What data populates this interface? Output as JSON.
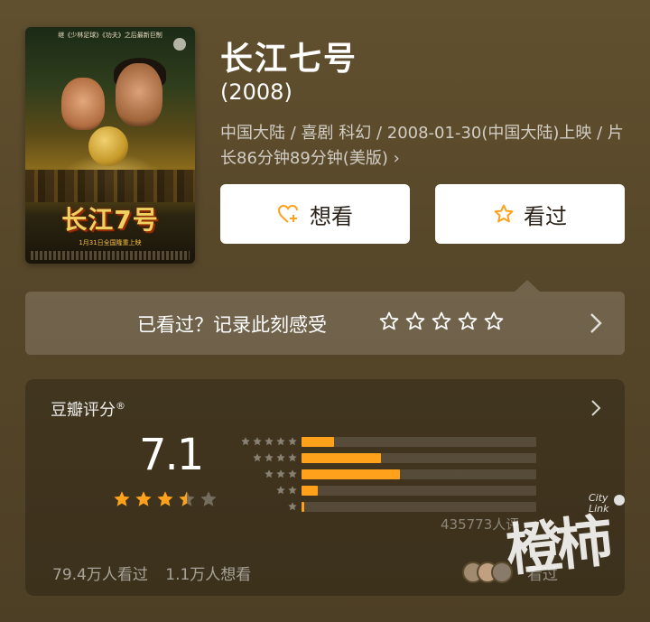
{
  "movie": {
    "title": "长江七号",
    "year": "(2008)",
    "meta": "中国大陆 / 喜剧 科幻 / 2008-01-30(中国大陆)上映 / 片长86分钟89分钟(美版) ›",
    "poster": {
      "top_text": "继《少林足球》《功夫》之后最新巨制",
      "title_art": "长江7号",
      "release_line": "1月31日全国隆重上映"
    }
  },
  "actions": {
    "want_label": "想看",
    "seen_label": "看过",
    "want_icon": "heart-plus-icon",
    "seen_icon": "star-outline-icon",
    "accent": "#ffa11a"
  },
  "record": {
    "prompt": "已看过？记录此刻感受",
    "star_count": 5
  },
  "rating": {
    "header": "豆瓣评分",
    "registered_mark": "®",
    "score": "7.1",
    "stars_fill": 3.5,
    "distribution": [
      {
        "stars": 5,
        "fraction": 0.14
      },
      {
        "stars": 4,
        "fraction": 0.34
      },
      {
        "stars": 3,
        "fraction": 0.42
      },
      {
        "stars": 2,
        "fraction": 0.07
      },
      {
        "stars": 1,
        "fraction": 0.01
      }
    ],
    "count": "435773人评",
    "seen_count": "79.4万人看过",
    "want_count": "1.1万人想看",
    "friends_seen": "看过"
  },
  "watermark": {
    "text": "橙柿",
    "city": "City",
    "link": "Link"
  }
}
